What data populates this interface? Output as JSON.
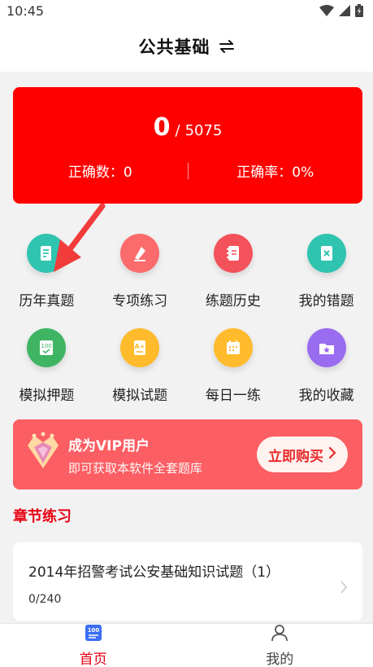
{
  "status_bar": {
    "time": "10:45",
    "icons": [
      "wifi-icon",
      "signal-icon",
      "battery-icon"
    ]
  },
  "header": {
    "title": "公共基础",
    "switch_icon": "swap-arrows-icon"
  },
  "score": {
    "done": "0",
    "separator": "/",
    "total": "5075",
    "correct_count": "正确数：0",
    "correct_rate": "正确率：0%"
  },
  "menu": [
    {
      "label": "历年真题",
      "icon": "document-icon",
      "color": "#2ec4b0"
    },
    {
      "label": "专项练习",
      "icon": "pen-icon",
      "color": "#fb6b6b"
    },
    {
      "label": "练题历史",
      "icon": "notebook-icon",
      "color": "#f4525a"
    },
    {
      "label": "我的错题",
      "icon": "error-book-icon",
      "color": "#2ec4b0"
    },
    {
      "label": "模拟押题",
      "icon": "score-100-icon",
      "color": "#3fb563"
    },
    {
      "label": "模拟试题",
      "icon": "exam-paper-icon",
      "color": "#ffbb2c"
    },
    {
      "label": "每日一练",
      "icon": "calendar-icon",
      "color": "#ffbb2c"
    },
    {
      "label": "我的收藏",
      "icon": "star-folder-icon",
      "color": "#9a6cf0"
    }
  ],
  "vip": {
    "title": "成为VIP用户",
    "subtitle": "即可获取本软件全套题库",
    "button": "立即购买"
  },
  "section": {
    "title": "章节练习"
  },
  "chapters": [
    {
      "title": "2014年招警考试公安基础知识试题（1）",
      "progress": "0/240"
    }
  ],
  "bottom_nav": {
    "home": {
      "label": "首页",
      "icon": "home-100-icon"
    },
    "mine": {
      "label": "我的",
      "icon": "user-icon"
    }
  },
  "colors": {
    "primary": "#ff0000",
    "accent_red": "#e60012",
    "vip_bg": "#fb5e63"
  }
}
